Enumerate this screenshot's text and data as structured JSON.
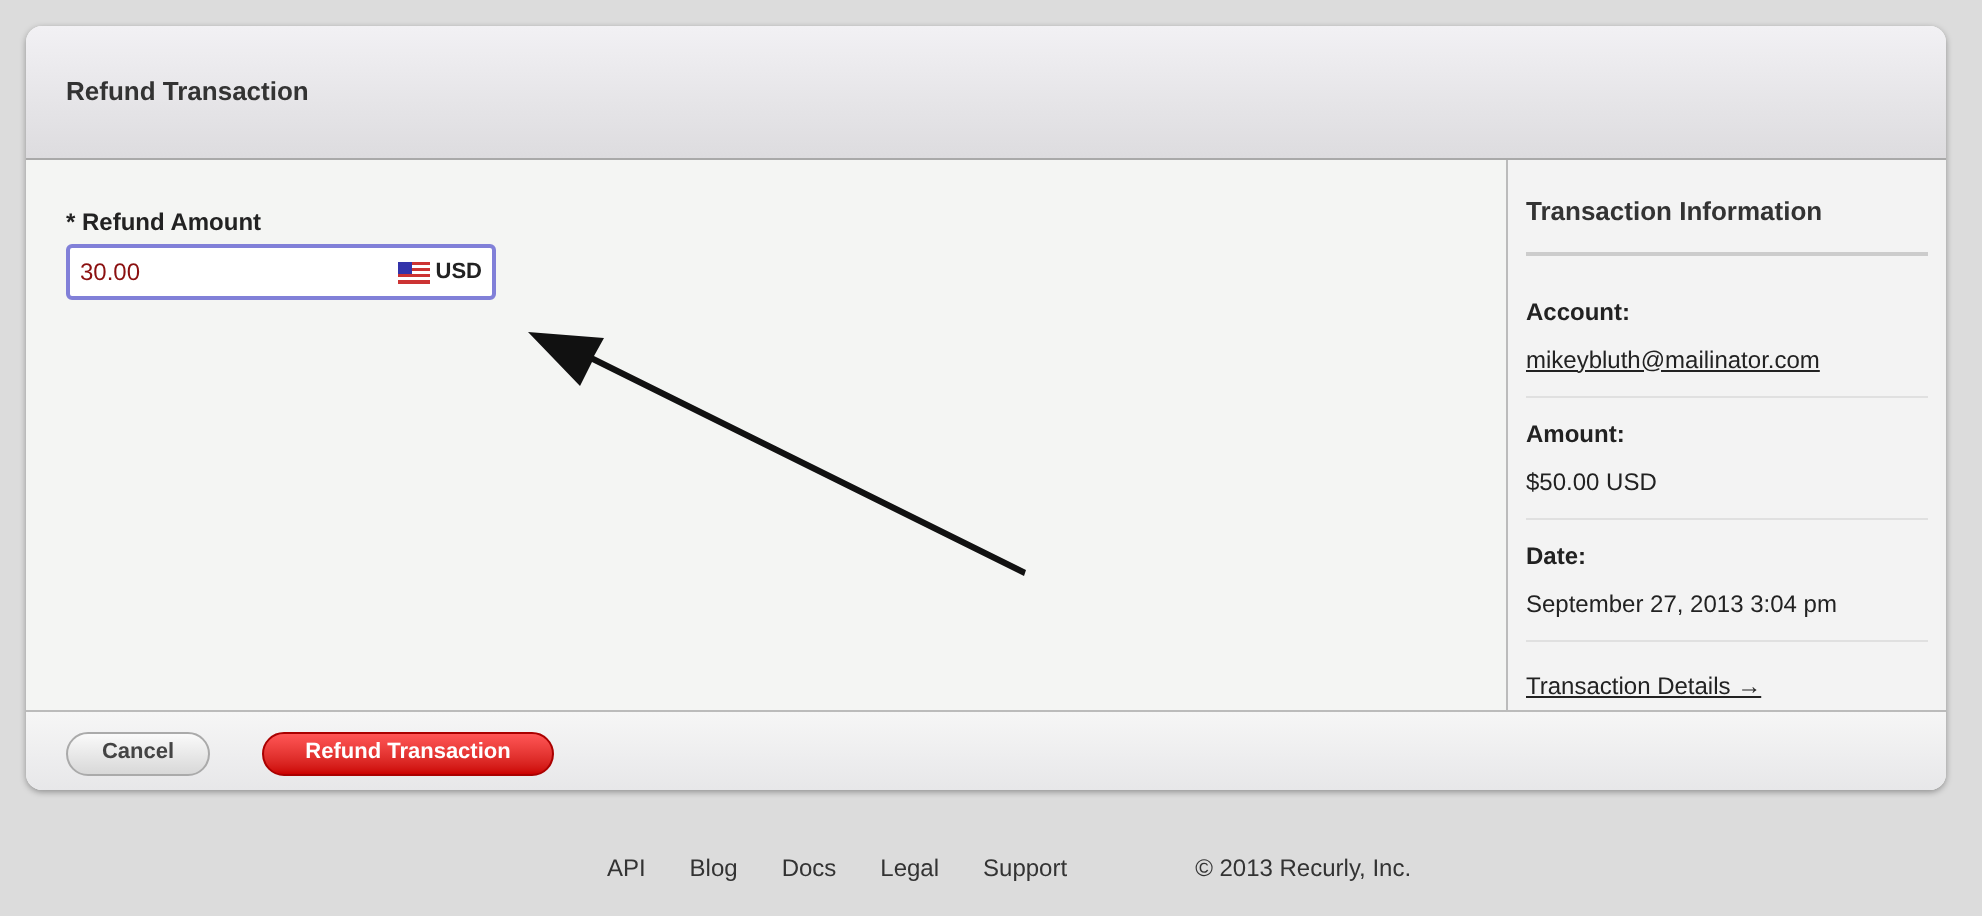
{
  "panel": {
    "title": "Refund Transaction"
  },
  "form": {
    "label": "* Refund Amount",
    "value": "30.00",
    "currency": "USD"
  },
  "sidebar": {
    "title": "Transaction Information",
    "items": [
      {
        "kind": "link",
        "label": "Account:",
        "value": "mikeybluth@mailinator.com"
      },
      {
        "kind": "text",
        "label": "Amount:",
        "value": "$50.00 USD"
      },
      {
        "kind": "text",
        "label": "Date:",
        "value": "September 27, 2013 3:04 pm"
      }
    ],
    "details_link": "Transaction Details →"
  },
  "buttons": {
    "cancel": "Cancel",
    "submit": "Refund Transaction"
  },
  "footer": {
    "links": [
      "API",
      "Blog",
      "Docs",
      "Legal",
      "Support"
    ],
    "copyright": "© 2013 Recurly, Inc."
  }
}
